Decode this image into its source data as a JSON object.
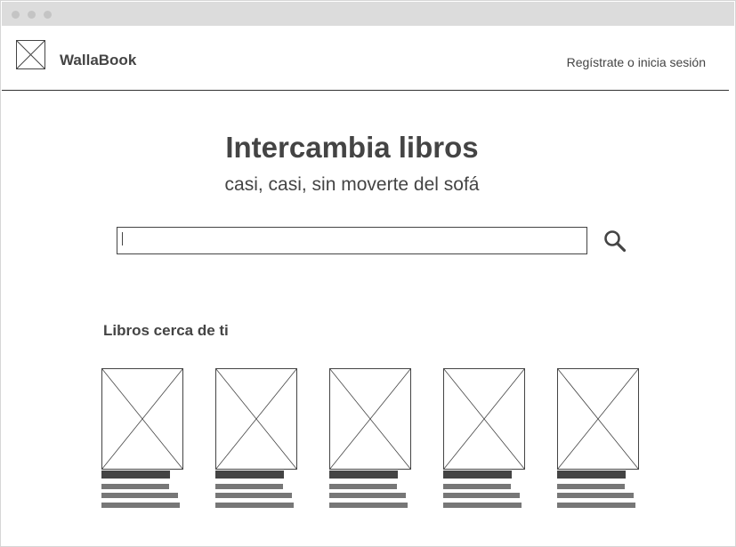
{
  "header": {
    "brand": "WallaBook",
    "login_label": "Regístrate o inicia sesión",
    "logo_icon": "image-placeholder-icon"
  },
  "hero": {
    "title": "Intercambia libros",
    "subtitle": "casi, casi, sin moverte del sofá"
  },
  "search": {
    "value": "",
    "placeholder": "",
    "icon": "search-icon"
  },
  "nearby": {
    "title": "Libros cerca de ti",
    "books": [
      {
        "cover_icon": "image-placeholder-icon"
      },
      {
        "cover_icon": "image-placeholder-icon"
      },
      {
        "cover_icon": "image-placeholder-icon"
      },
      {
        "cover_icon": "image-placeholder-icon"
      },
      {
        "cover_icon": "image-placeholder-icon"
      }
    ]
  },
  "colors": {
    "text": "#444444",
    "titlebar": "#dcdcdc",
    "placeholder_bar_dark": "#444444",
    "placeholder_bar_light": "#777777"
  }
}
